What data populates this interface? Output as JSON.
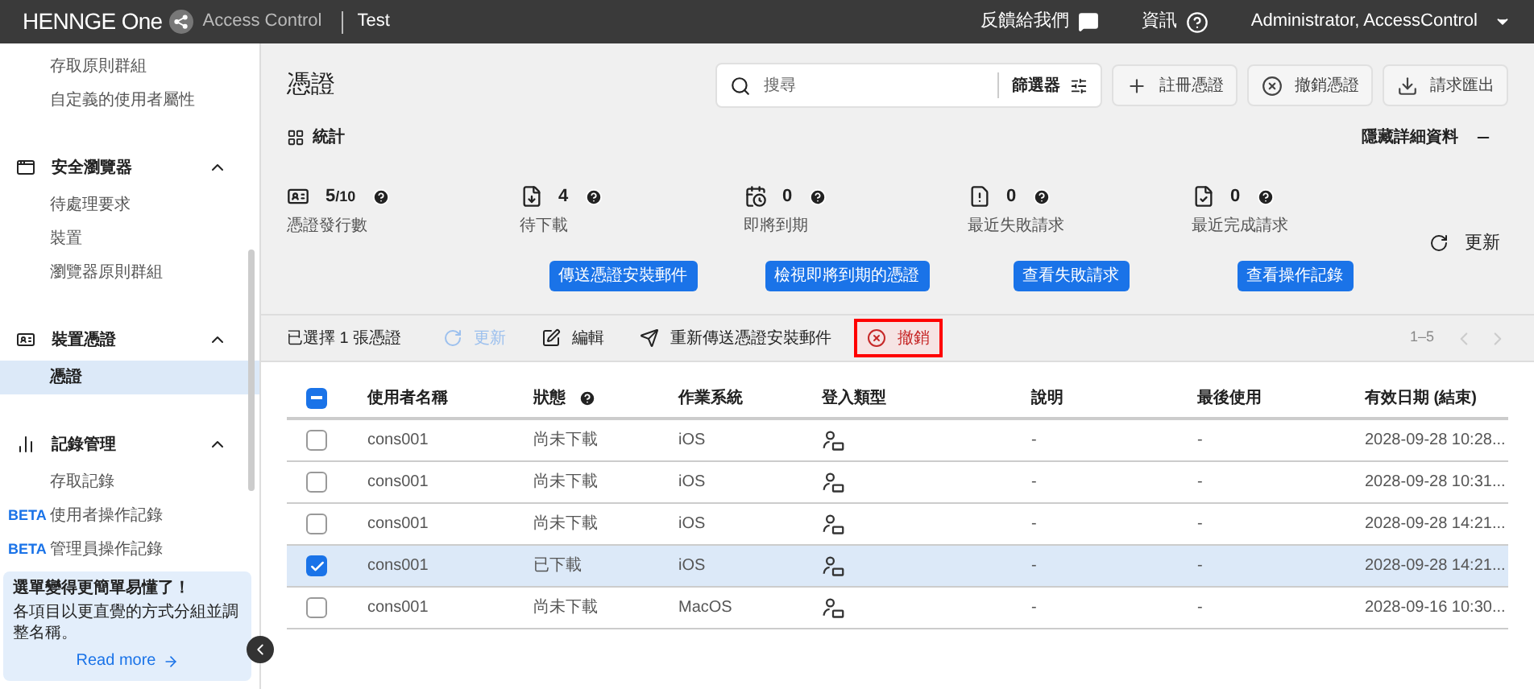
{
  "header": {
    "brand": "HENNGE One",
    "product": "Access Control",
    "tenant": "Test",
    "feedback": "反饋給我們",
    "info": "資訊",
    "user": "Administrator, AccessControl"
  },
  "sidebar": {
    "groups": [
      {
        "kind": "plain",
        "children": [
          {
            "label": "存取原則群組",
            "selected": false
          },
          {
            "label": "自定義的使用者屬性",
            "selected": false
          }
        ]
      },
      {
        "kind": "section",
        "label": "安全瀏覽器",
        "expanded": true,
        "children": [
          {
            "label": "待處理要求",
            "selected": false
          },
          {
            "label": "裝置",
            "selected": false
          },
          {
            "label": "瀏覽器原則群組",
            "selected": false
          }
        ]
      },
      {
        "kind": "section",
        "label": "裝置憑證",
        "expanded": true,
        "children": [
          {
            "label": "憑證",
            "selected": true
          }
        ]
      },
      {
        "kind": "section",
        "label": "記錄管理",
        "expanded": true,
        "children": [
          {
            "label": "存取記錄",
            "selected": false
          },
          {
            "badge": "BETA",
            "label": "使用者操作記錄",
            "selected": false
          },
          {
            "badge": "BETA",
            "label": "管理員操作記錄",
            "selected": false
          }
        ]
      }
    ]
  },
  "banner": {
    "title": "選單變得更簡單易懂了！",
    "text": "各項目以更直覺的方式分組並調整名稱。",
    "link": "Read more"
  },
  "page": {
    "title": "憑證",
    "search": {
      "placeholder": "搜尋"
    },
    "filter": "篩選器",
    "actions": [
      {
        "kind": "add",
        "label": "註冊憑證"
      },
      {
        "kind": "revoke",
        "label": "撤銷憑證"
      },
      {
        "kind": "export",
        "label": "請求匯出"
      }
    ]
  },
  "stats": {
    "title": "統計",
    "hide": "隱藏詳細資料",
    "refresh": "更新",
    "cards": [
      {
        "value": "5",
        "total": "/10",
        "label": "憑證發行數"
      },
      {
        "value": "4",
        "label": "待下載",
        "button": "傳送憑證安裝郵件"
      },
      {
        "value": "0",
        "label": "即將到期",
        "button": "檢視即將到期的憑證"
      },
      {
        "value": "0",
        "label": "最近失敗請求",
        "button": "查看失敗請求"
      },
      {
        "value": "0",
        "label": "最近完成請求",
        "button": "查看操作記錄"
      }
    ]
  },
  "toolbar": {
    "selection": "已選擇 1 張憑證",
    "range": "1–5",
    "actions": [
      {
        "kind": "refresh",
        "label": "更新",
        "disabled": true,
        "highlighted": false
      },
      {
        "kind": "edit",
        "label": "編輯",
        "disabled": false,
        "highlighted": false
      },
      {
        "kind": "send",
        "label": "重新傳送憑證安裝郵件",
        "disabled": false,
        "highlighted": false
      },
      {
        "kind": "revoke",
        "label": "撤銷",
        "disabled": false,
        "highlighted": true
      }
    ]
  },
  "table": {
    "select_all": {
      "indeterminate": true
    },
    "columns": [
      {
        "label": "使用者名稱"
      },
      {
        "label": "狀態",
        "help": true
      },
      {
        "label": "作業系統"
      },
      {
        "label": "登入類型"
      },
      {
        "label": "說明"
      },
      {
        "label": "最後使用"
      },
      {
        "label": "有效日期 (結束)"
      }
    ],
    "rows": [
      {
        "selected": false,
        "user": "cons001",
        "status": "尚未下載",
        "os": "iOS",
        "description": "-",
        "last_used": "-",
        "expires": "2028-09-28 10:28..."
      },
      {
        "selected": false,
        "user": "cons001",
        "status": "尚未下載",
        "os": "iOS",
        "description": "-",
        "last_used": "-",
        "expires": "2028-09-28 10:31..."
      },
      {
        "selected": false,
        "user": "cons001",
        "status": "尚未下載",
        "os": "iOS",
        "description": "-",
        "last_used": "-",
        "expires": "2028-09-28 14:21..."
      },
      {
        "selected": true,
        "user": "cons001",
        "status": "已下載",
        "os": "iOS",
        "description": "-",
        "last_used": "-",
        "expires": "2028-09-28 14:21..."
      },
      {
        "selected": false,
        "user": "cons001",
        "status": "尚未下載",
        "os": "MacOS",
        "description": "-",
        "last_used": "-",
        "expires": "2028-09-16 10:30..."
      }
    ]
  }
}
